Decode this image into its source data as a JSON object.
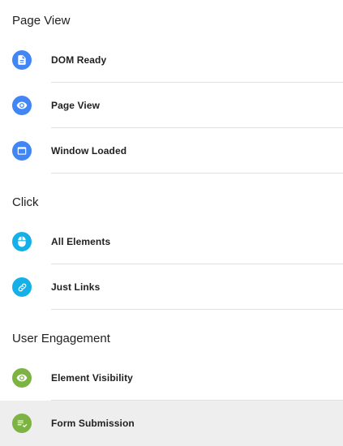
{
  "sections": [
    {
      "title": "Page View",
      "items": [
        {
          "label": "DOM Ready",
          "icon": "document-icon",
          "color": "#4285f4"
        },
        {
          "label": "Page View",
          "icon": "eye-icon",
          "color": "#4285f4"
        },
        {
          "label": "Window Loaded",
          "icon": "window-icon",
          "color": "#4285f4"
        }
      ]
    },
    {
      "title": "Click",
      "items": [
        {
          "label": "All Elements",
          "icon": "mouse-icon",
          "color": "#15b0e8"
        },
        {
          "label": "Just Links",
          "icon": "link-icon",
          "color": "#15b0e8"
        }
      ]
    },
    {
      "title": "User Engagement",
      "items": [
        {
          "label": "Element Visibility",
          "icon": "eye-icon",
          "color": "#7cb342"
        },
        {
          "label": "Form Submission",
          "icon": "form-check-icon",
          "color": "#7cb342",
          "selected": true
        }
      ]
    }
  ]
}
